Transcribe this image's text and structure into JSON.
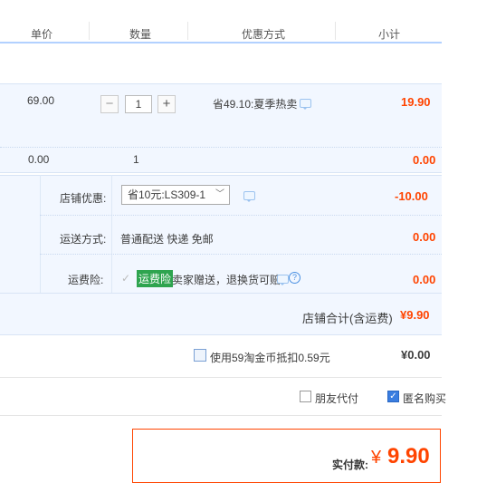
{
  "header": {
    "unit_price": "单价",
    "quantity": "数量",
    "discount_method": "优惠方式",
    "subtotal": "小计"
  },
  "item1": {
    "unit_price": "69.00",
    "quantity": "1",
    "minus": "−",
    "plus": "+",
    "promo": "省49.10:夏季热卖",
    "subtotal": "19.90"
  },
  "item2": {
    "unit_price": "0.00",
    "quantity": "1",
    "subtotal": "0.00"
  },
  "shop": {
    "discount_label": "店铺优惠:",
    "discount_value": "省10元:LS309-1",
    "discount_amount": "-10.00",
    "shipping_label": "运送方式:",
    "shipping_value": "普通配送 快递 免邮",
    "shipping_amount": "0.00",
    "insurance_label": "运费险:",
    "insurance_badge": "运费险",
    "insurance_text": "卖家赠送，退换货可赔",
    "insurance_amount": "0.00",
    "total_label": "店铺合计(含运费)",
    "total_amount": "¥9.90"
  },
  "coins": {
    "label": "使用59淘金币抵扣0.59元",
    "amount": "¥0.00"
  },
  "options": {
    "friend_pay": "朋友代付",
    "anonymous": "匿名购买"
  },
  "summary": {
    "label": "实付款:",
    "currency": "¥",
    "amount": "9.90"
  },
  "colors": {
    "accent": "#3a7de0",
    "price_red": "#ff4400",
    "badge_green": "#2ea44f"
  }
}
